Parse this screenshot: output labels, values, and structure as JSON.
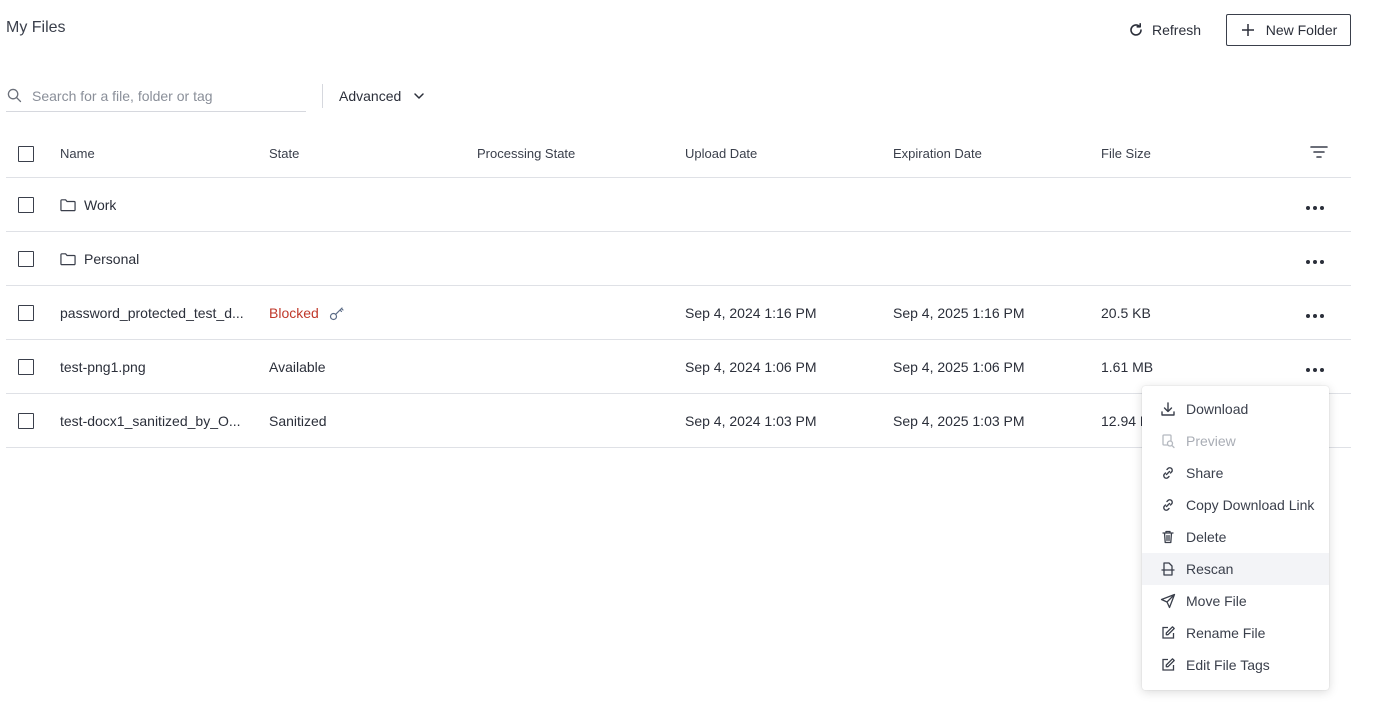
{
  "header": {
    "title": "My Files",
    "refresh_label": "Refresh",
    "new_folder_label": "New Folder"
  },
  "search": {
    "placeholder": "Search for a file, folder or tag",
    "advanced_label": "Advanced"
  },
  "table": {
    "columns": {
      "name": "Name",
      "state": "State",
      "processing_state": "Processing State",
      "upload_date": "Upload Date",
      "expiration_date": "Expiration Date",
      "file_size": "File Size"
    },
    "rows": [
      {
        "type": "folder",
        "name": "Work",
        "state": "",
        "processing_state": "",
        "upload_date": "",
        "expiration_date": "",
        "file_size": ""
      },
      {
        "type": "folder",
        "name": "Personal",
        "state": "",
        "processing_state": "",
        "upload_date": "",
        "expiration_date": "",
        "file_size": ""
      },
      {
        "type": "file",
        "name": "password_protected_test_d...",
        "state": "Blocked",
        "processing_state": "",
        "upload_date": "Sep 4, 2024 1:16 PM",
        "expiration_date": "Sep 4, 2025 1:16 PM",
        "file_size": "20.5 KB"
      },
      {
        "type": "file",
        "name": "test-png1.png",
        "state": "Available",
        "processing_state": "",
        "upload_date": "Sep 4, 2024 1:06 PM",
        "expiration_date": "Sep 4, 2025 1:06 PM",
        "file_size": "1.61 MB"
      },
      {
        "type": "file",
        "name": "test-docx1_sanitized_by_O...",
        "state": "Sanitized",
        "processing_state": "",
        "upload_date": "Sep 4, 2024 1:03 PM",
        "expiration_date": "Sep 4, 2025 1:03 PM",
        "file_size": "12.94 KB"
      }
    ]
  },
  "context_menu": {
    "items": [
      {
        "label": "Download",
        "icon": "download-icon",
        "enabled": true
      },
      {
        "label": "Preview",
        "icon": "preview-icon",
        "enabled": false
      },
      {
        "label": "Share",
        "icon": "link-icon",
        "enabled": true
      },
      {
        "label": "Copy Download Link",
        "icon": "link-icon",
        "enabled": true
      },
      {
        "label": "Delete",
        "icon": "trash-icon",
        "enabled": true
      },
      {
        "label": "Rescan",
        "icon": "rescan-icon",
        "enabled": true,
        "highlighted": true
      },
      {
        "label": "Move File",
        "icon": "send-icon",
        "enabled": true
      },
      {
        "label": "Rename File",
        "icon": "edit-icon",
        "enabled": true
      },
      {
        "label": "Edit File Tags",
        "icon": "edit-icon",
        "enabled": true
      }
    ]
  },
  "colors": {
    "blocked": "#c0392b",
    "text": "#2b2f3a",
    "border": "#dfe1e6"
  }
}
